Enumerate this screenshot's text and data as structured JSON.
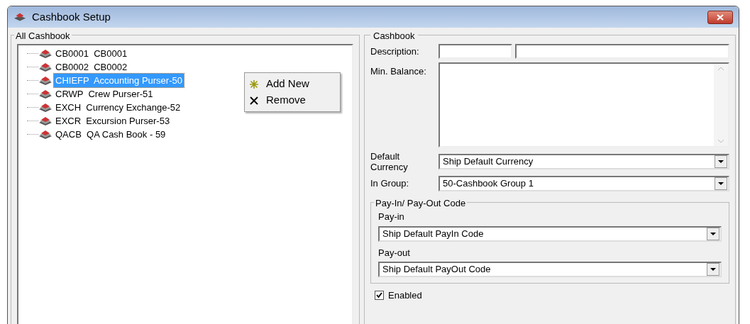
{
  "window": {
    "title": "Cashbook Setup"
  },
  "all_cashbook": {
    "title": "All Cashbook",
    "items": [
      {
        "label": "CB0001  CB0001",
        "selected": false
      },
      {
        "label": "CB0002  CB0002",
        "selected": false
      },
      {
        "label": "CHIEFP  Accounting Purser-50",
        "selected": true
      },
      {
        "label": "CRWP  Crew Purser-51",
        "selected": false
      },
      {
        "label": "EXCH  Currency Exchange-52",
        "selected": false
      },
      {
        "label": "EXCR  Excursion Purser-53",
        "selected": false
      },
      {
        "label": "QACB  QA Cash Book - 59",
        "selected": false
      }
    ]
  },
  "context_menu": [
    {
      "kind": "add",
      "label": "Add New"
    },
    {
      "kind": "remove",
      "label": "Remove"
    }
  ],
  "cashbook": {
    "title": "Cashbook",
    "description_label": "Description:",
    "min_balance_label": "Min. Balance:",
    "default_currency_label": "Default Currency",
    "default_currency": "Ship Default Currency",
    "in_group_label": "In Group:",
    "in_group": "50-Cashbook Group 1",
    "pay_codes": {
      "title": "Pay-In/ Pay-Out Code",
      "pay_in_label": "Pay-in",
      "pay_in": "Ship Default PayIn Code",
      "pay_out_label": "Pay-out",
      "pay_out": "Ship Default PayOut Code"
    },
    "enabled": {
      "label": "Enabled",
      "checked": true
    }
  }
}
